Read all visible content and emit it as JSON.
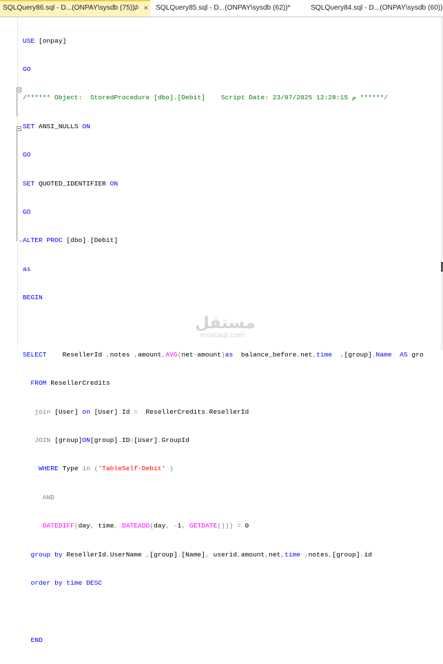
{
  "tabs": [
    {
      "label": "SQLQuery86.sql - D...(ONPAY\\sysdb (75))",
      "pin": "⊅",
      "close": "×"
    },
    {
      "label": "SQLQuery85.sql - D...(ONPAY\\sysdb (62))*"
    },
    {
      "label": "SQLQuery84.sql - D...(ONPAY\\sysdb (60))*"
    }
  ],
  "code": {
    "l1": {
      "a": "USE",
      "b": " [onpay]"
    },
    "l2": {
      "a": "GO"
    },
    "l3": {
      "a": "/****** Object:  StoredProcedure [dbo].[Debit]    Script Date: 23/07/2025 12:28:15 م ******/"
    },
    "l4": {
      "a": "SET",
      "b": " ANSI_NULLS ",
      "c": "ON"
    },
    "l5": {
      "a": "GO"
    },
    "l6": {
      "a": "SET",
      "b": " QUOTED_IDENTIFIER ",
      "c": "ON"
    },
    "l7": {
      "a": "GO"
    },
    "l8": {
      "a": "ALTER",
      "b": " ",
      "c": "PROC",
      "d": " [dbo]",
      "e": ".",
      "f": "[Debit]"
    },
    "l9": {
      "a": "as"
    },
    "l10": {
      "a": "BEGIN"
    },
    "l12": {
      "a": "SELECT",
      "b": "    ResellerId ",
      "c": ",",
      "d": "notes ",
      "e": ",",
      "f": "amount",
      "g": ",",
      "h": "AVG",
      "i": "(",
      "j": "net",
      "k": "-",
      "l": "amount",
      "m": ")",
      "n": "as",
      "o": "  balance_before",
      "p": ",",
      "q": "net",
      "r": ",",
      "s": "time",
      "t": "  ,",
      "u": "[group]",
      "v": ".",
      "w": "Name",
      "x": "  AS",
      "y": " gro"
    },
    "l13": {
      "a": "FROM",
      "b": " ResellerCredits"
    },
    "l14": {
      "a": "join",
      "b": " ",
      "c": "[User]",
      "d": " ",
      "e": "on",
      "f": " [User]",
      "g": ".",
      "h": "Id ",
      "i": "=",
      "j": "  ResellerCredits",
      "k": ".",
      "l": "ResellerId"
    },
    "l15": {
      "a": "JOIN",
      "b": " [group]",
      "c": "ON",
      "d": "[group]",
      "e": ".",
      "f": "ID",
      "g": "=",
      "h": "[User]",
      "i": ".",
      "j": "GroupId"
    },
    "l16": {
      "a": "WHERE",
      "b": " Type ",
      "c": "in",
      "d": " (",
      "e": "'TableSelf-Debit'",
      "f": " )"
    },
    "l17": {
      "a": "AND"
    },
    "l18": {
      "a": "DATEDIFF",
      "b": "(",
      "c": "day",
      "d": ",",
      "e": " time",
      "f": ",",
      "g": " ",
      "h": "DATEADD",
      "i": "(",
      "j": "day",
      "k": ",",
      "l": " -",
      "m": "1",
      "n": ",",
      "o": " ",
      "p": "GETDATE",
      "q": "()))",
      "r": " =",
      "s": " 0"
    },
    "l19": {
      "a": "group",
      "b": " ",
      "c": "by",
      "d": " ResellerId",
      "e": ",",
      "f": "UserName ",
      "g": ",",
      "h": "[group]",
      "i": ".",
      "j": "[Name]",
      "k": ",",
      "l": " userid",
      "m": ",",
      "n": "amount",
      "o": ",",
      "p": "net",
      "q": ",",
      "r": "time",
      "s": " ,",
      "t": "notes",
      "u": ",",
      "v": "[group]",
      "w": ".",
      "x": "id"
    },
    "l20": {
      "a": "order",
      "b": " ",
      "c": "by",
      "d": " ",
      "e": "time",
      "f": " ",
      "g": "DESC"
    },
    "l22": {
      "a": "END"
    }
  },
  "watermark": {
    "logo": "مستقل",
    "url": "mostaql.com"
  }
}
